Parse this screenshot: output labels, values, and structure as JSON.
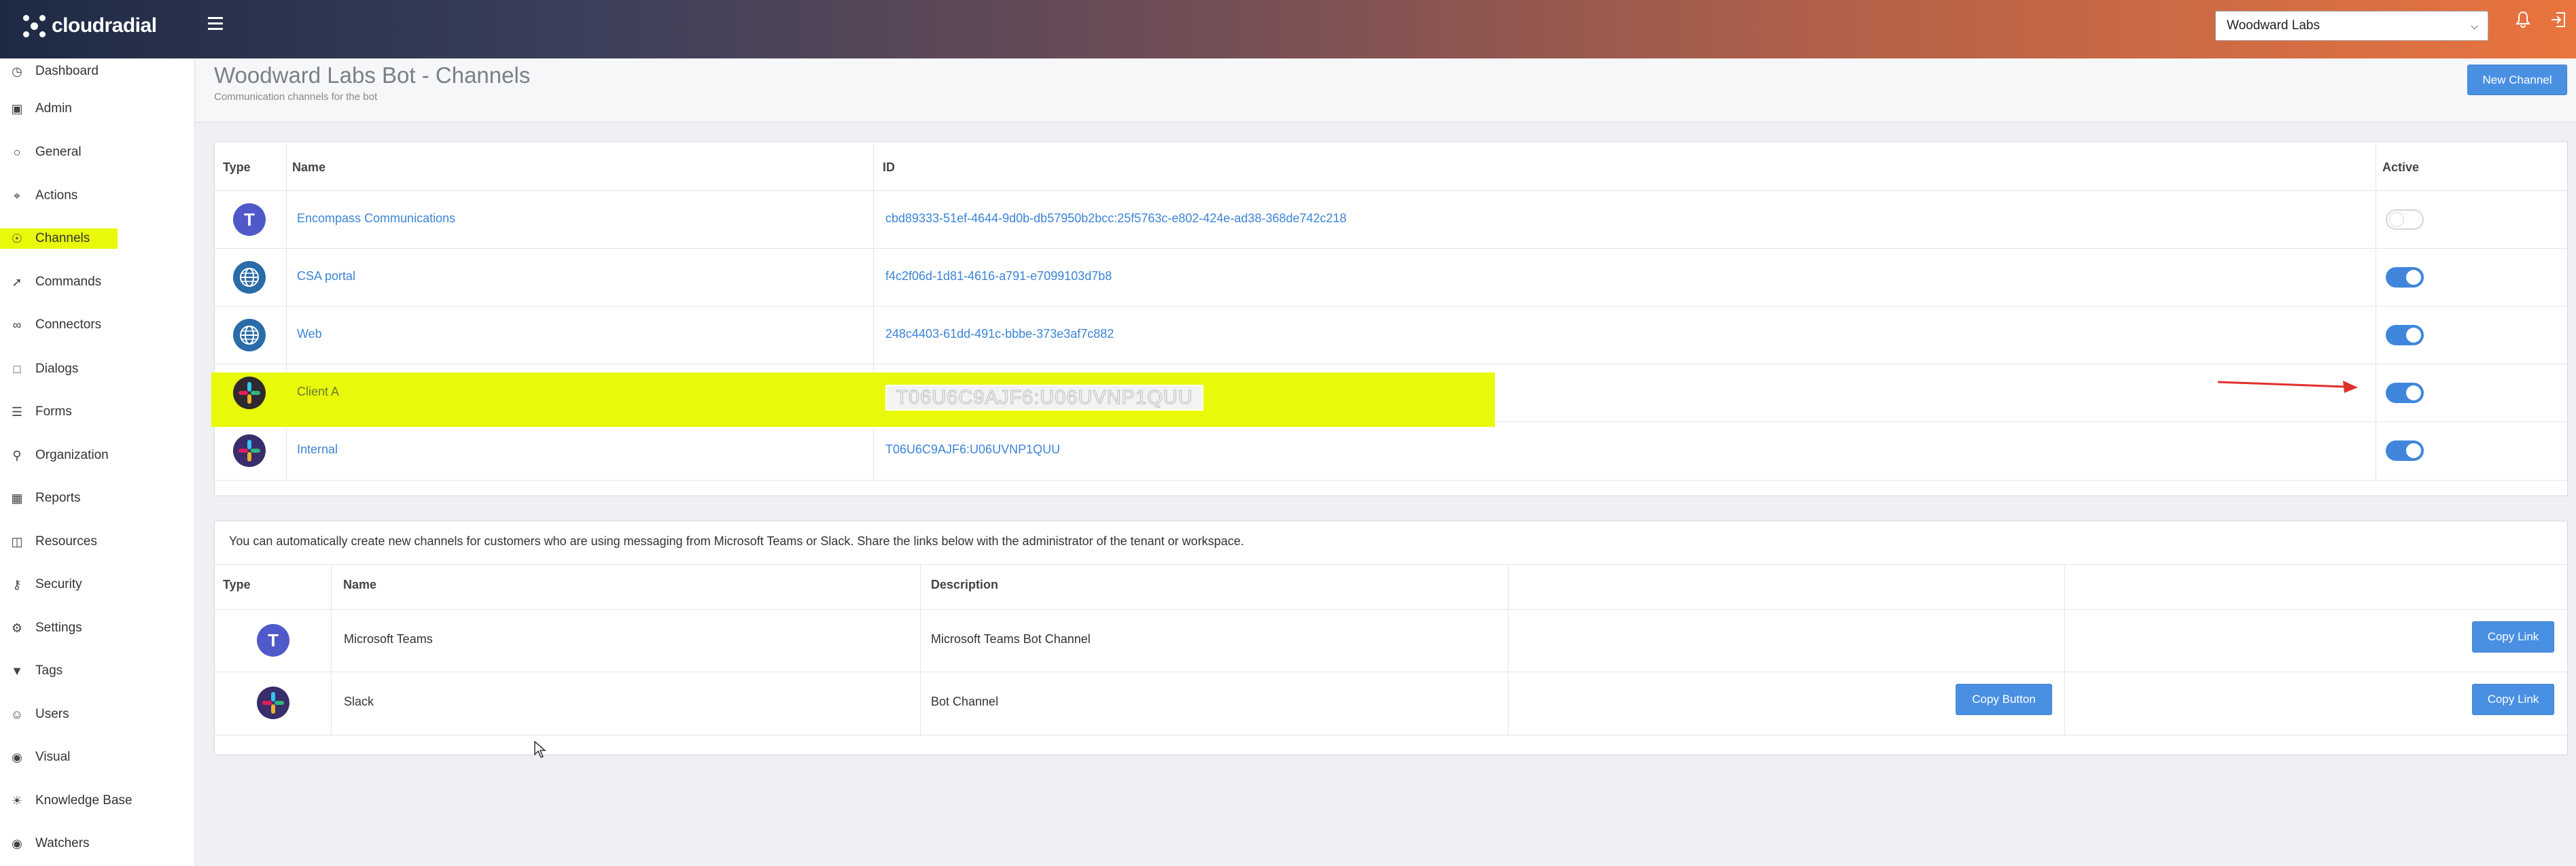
{
  "topbar": {
    "brand": "cloudradial",
    "tenant_selected": "Woodward Labs"
  },
  "sidebar": {
    "items": [
      {
        "label": "Dashboard",
        "icon": "dashboard-icon"
      },
      {
        "label": "Admin",
        "icon": "briefcase-icon"
      },
      {
        "label": "General",
        "icon": "circle-icon"
      },
      {
        "label": "Actions",
        "icon": "actions-icon"
      },
      {
        "label": "Channels",
        "icon": "globe-icon",
        "active": true
      },
      {
        "label": "Commands",
        "icon": "wrench-icon"
      },
      {
        "label": "Connectors",
        "icon": "link-icon"
      },
      {
        "label": "Dialogs",
        "icon": "dialog-icon"
      },
      {
        "label": "Forms",
        "icon": "list-icon"
      },
      {
        "label": "Organization",
        "icon": "org-icon"
      },
      {
        "label": "Reports",
        "icon": "grid-icon"
      },
      {
        "label": "Resources",
        "icon": "book-icon"
      },
      {
        "label": "Security",
        "icon": "key-icon"
      },
      {
        "label": "Settings",
        "icon": "gear-icon"
      },
      {
        "label": "Tags",
        "icon": "tag-icon"
      },
      {
        "label": "Users",
        "icon": "user-icon"
      },
      {
        "label": "Visual",
        "icon": "eye-icon"
      },
      {
        "label": "Knowledge Base",
        "icon": "lightbulb-icon"
      },
      {
        "label": "Watchers",
        "icon": "eye-icon"
      }
    ]
  },
  "page": {
    "title": "Woodward Labs Bot - Channels",
    "subtitle": "Communication channels for the bot",
    "new_channel_label": "New Channel"
  },
  "channels_table": {
    "headers": {
      "type": "Type",
      "name": "Name",
      "id": "ID",
      "active": "Active"
    },
    "rows": [
      {
        "type": "teams",
        "name": "Encompass Communications",
        "id": "cbd89333-51ef-4644-9d0b-db57950b2bcc:25f5763c-e802-424e-ad38-368de742c218",
        "active": false
      },
      {
        "type": "web",
        "name": "CSA portal",
        "id": "f4c2f06d-1d81-4616-a791-e7099103d7b8",
        "active": true
      },
      {
        "type": "web",
        "name": "Web",
        "id": "248c4403-61dd-491c-bbbe-373e3af7c882",
        "active": true
      },
      {
        "type": "slack",
        "name": "Client A",
        "id": "T06U6C9AJF6:U06UVNP1QUU",
        "active": true
      },
      {
        "type": "slack",
        "name": "Internal",
        "id": "T06U6C9AJF6:U06UVNP1QUU",
        "active": true
      }
    ]
  },
  "auto_create": {
    "info": "You can automatically create new channels for customers who are using messaging from Microsoft Teams or Slack. Share the links below with the administrator of the tenant or workspace.",
    "headers": {
      "type": "Type",
      "name": "Name",
      "description": "Description"
    },
    "rows": [
      {
        "type": "teams",
        "name": "Microsoft Teams",
        "description": "Microsoft Teams Bot Channel",
        "copy_link": "Copy Link"
      },
      {
        "type": "slack",
        "name": "Slack",
        "description": "Bot Channel",
        "copy_button": "Copy Button",
        "copy_link": "Copy Link"
      }
    ]
  },
  "colors": {
    "accent": "#4a90e2",
    "highlight": "#e8f90a",
    "link": "#3c84d6"
  }
}
